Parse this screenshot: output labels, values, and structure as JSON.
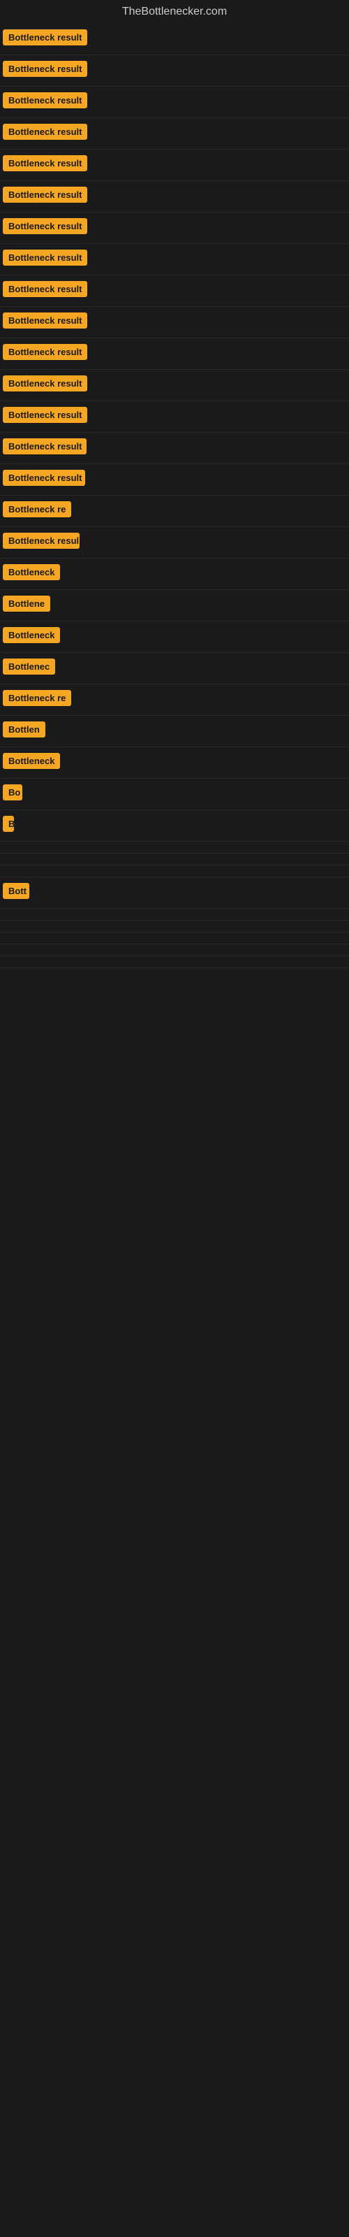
{
  "site": {
    "title": "TheBottlenecker.com"
  },
  "rows": [
    {
      "id": 1,
      "label": "Bottleneck result",
      "width": 140
    },
    {
      "id": 2,
      "label": "Bottleneck result",
      "width": 140
    },
    {
      "id": 3,
      "label": "Bottleneck result",
      "width": 140
    },
    {
      "id": 4,
      "label": "Bottleneck result",
      "width": 130
    },
    {
      "id": 5,
      "label": "Bottleneck result",
      "width": 135
    },
    {
      "id": 6,
      "label": "Bottleneck result",
      "width": 130
    },
    {
      "id": 7,
      "label": "Bottleneck result",
      "width": 135
    },
    {
      "id": 8,
      "label": "Bottleneck result",
      "width": 130
    },
    {
      "id": 9,
      "label": "Bottleneck result",
      "width": 130
    },
    {
      "id": 10,
      "label": "Bottleneck result",
      "width": 128
    },
    {
      "id": 11,
      "label": "Bottleneck result",
      "width": 128
    },
    {
      "id": 12,
      "label": "Bottleneck result",
      "width": 125
    },
    {
      "id": 13,
      "label": "Bottleneck result",
      "width": 122
    },
    {
      "id": 14,
      "label": "Bottleneck result",
      "width": 120
    },
    {
      "id": 15,
      "label": "Bottleneck result",
      "width": 118
    },
    {
      "id": 16,
      "label": "Bottleneck re",
      "width": 100
    },
    {
      "id": 17,
      "label": "Bottleneck resul",
      "width": 110
    },
    {
      "id": 18,
      "label": "Bottleneck",
      "width": 82
    },
    {
      "id": 19,
      "label": "Bottlene",
      "width": 68
    },
    {
      "id": 20,
      "label": "Bottleneck",
      "width": 82
    },
    {
      "id": 21,
      "label": "Bottlenec",
      "width": 75
    },
    {
      "id": 22,
      "label": "Bottleneck re",
      "width": 100
    },
    {
      "id": 23,
      "label": "Bottlen",
      "width": 62
    },
    {
      "id": 24,
      "label": "Bottleneck",
      "width": 82
    },
    {
      "id": 25,
      "label": "Bo",
      "width": 28
    },
    {
      "id": 26,
      "label": "B",
      "width": 14
    },
    {
      "id": 27,
      "label": "",
      "width": 0
    },
    {
      "id": 28,
      "label": "",
      "width": 8
    },
    {
      "id": 29,
      "label": "",
      "width": 0
    },
    {
      "id": 30,
      "label": "Bott",
      "width": 38
    },
    {
      "id": 31,
      "label": "",
      "width": 0
    },
    {
      "id": 32,
      "label": "",
      "width": 0
    },
    {
      "id": 33,
      "label": "",
      "width": 0
    },
    {
      "id": 34,
      "label": "",
      "width": 0
    },
    {
      "id": 35,
      "label": "",
      "width": 0
    }
  ],
  "accent_color": "#f5a623"
}
